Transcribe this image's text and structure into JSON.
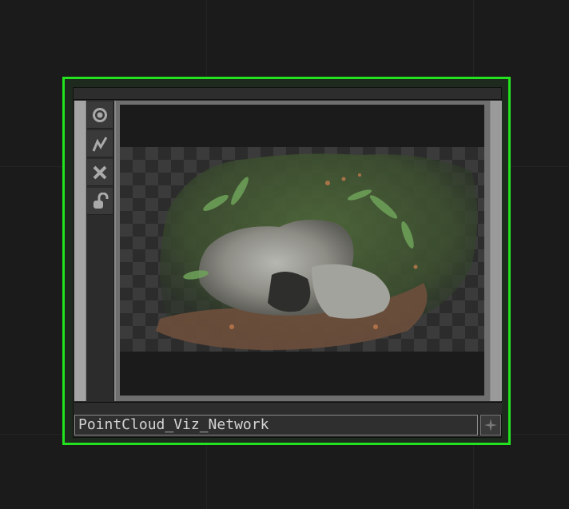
{
  "network_editor": {
    "background_color": "#1b1b1c",
    "grid_color": "#232426"
  },
  "node": {
    "name": "PointCloud_Viz_Network",
    "selected": true,
    "selection_color": "#22e31e",
    "viewer": {
      "content": "point-cloud render of mossy rocks and ferns over transparency checkerboard",
      "background": "checkerboard"
    },
    "side_icons": [
      {
        "name": "viewer-active-icon",
        "glyph": "target-circle"
      },
      {
        "name": "cook-flag-icon",
        "glyph": "zig-zag"
      },
      {
        "name": "bypass-icon",
        "glyph": "x"
      },
      {
        "name": "lock-icon",
        "glyph": "open-padlock"
      }
    ],
    "pin_icon": "sparkle-pin"
  }
}
